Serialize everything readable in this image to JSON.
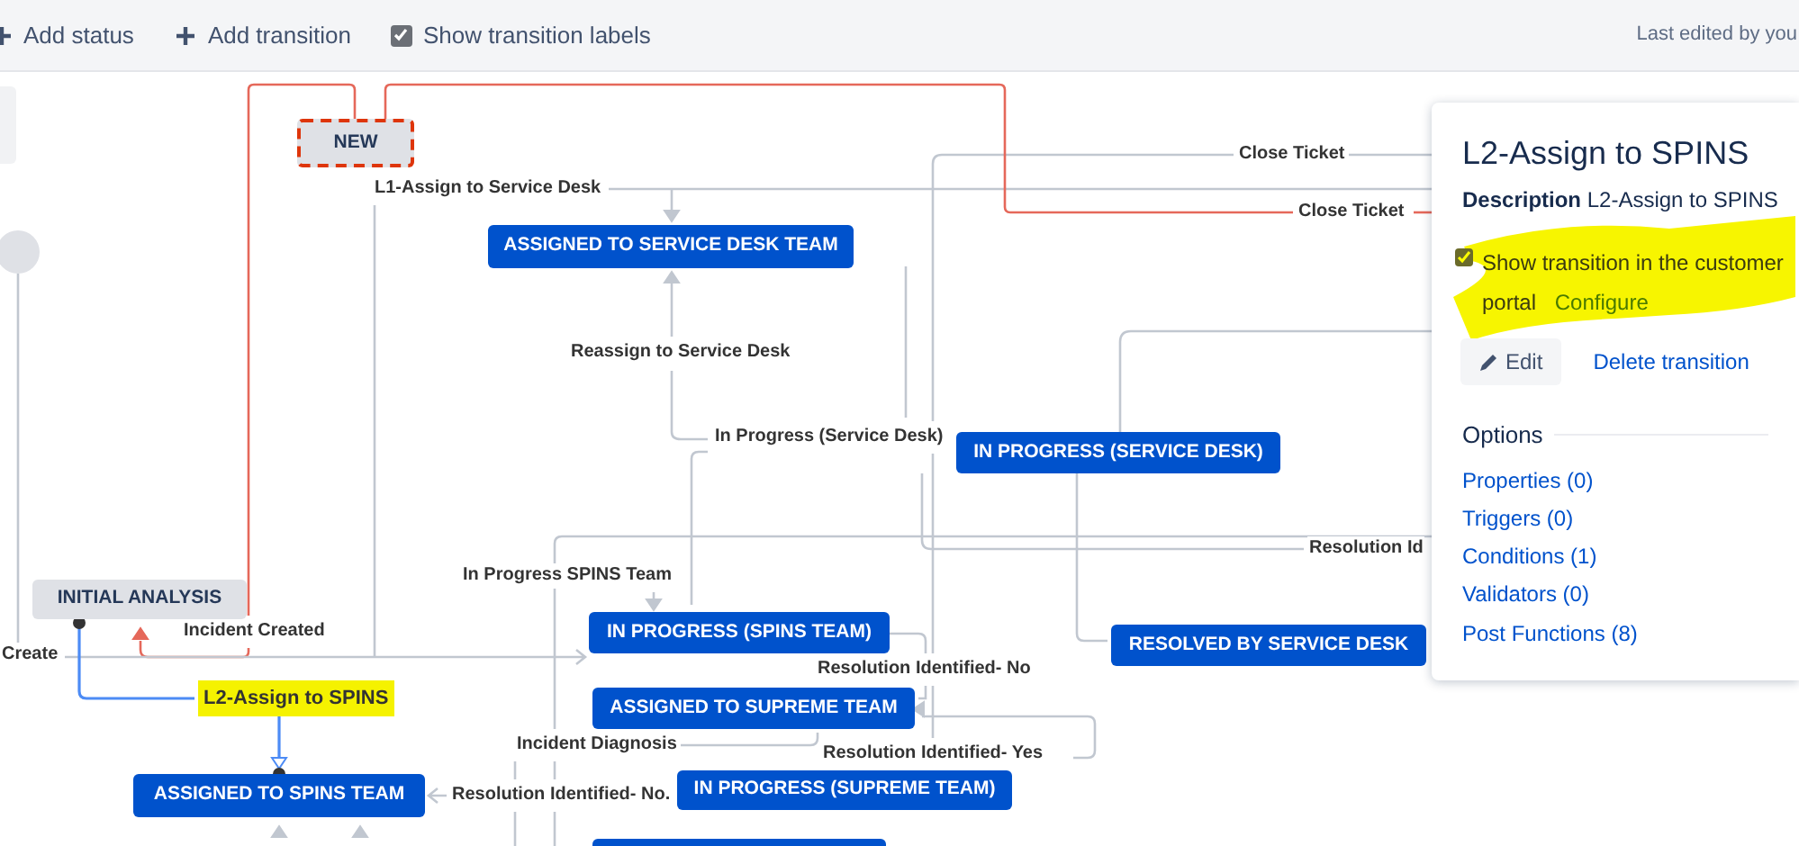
{
  "toolbar": {
    "actions": [
      {
        "label": "Add status"
      },
      {
        "label": "Add transition"
      }
    ],
    "show_labels": {
      "label": "Show transition labels",
      "checked": true
    },
    "last_edited": "Last edited by you"
  },
  "diagram": {
    "statuses": [
      {
        "name": "NEW",
        "kind": "new"
      },
      {
        "name": "ASSIGNED TO SERVICE DESK TEAM",
        "kind": "in-progress"
      },
      {
        "name": "IN PROGRESS (SERVICE DESK)",
        "kind": "in-progress"
      },
      {
        "name": "INITIAL ANALYSIS",
        "kind": "todo"
      },
      {
        "name": "IN PROGRESS (SPINS TEAM)",
        "kind": "in-progress"
      },
      {
        "name": "RESOLVED BY SERVICE DESK",
        "kind": "in-progress"
      },
      {
        "name": "ASSIGNED TO SUPREME TEAM",
        "kind": "in-progress"
      },
      {
        "name": "ASSIGNED TO SPINS TEAM",
        "kind": "in-progress"
      },
      {
        "name": "IN PROGRESS (SUPREME TEAM)",
        "kind": "in-progress"
      },
      {
        "kind": "in-progress"
      }
    ],
    "transitions": [
      {
        "label": "Close Ticket",
        "selected": false,
        "related": false
      },
      {
        "label": "L1-Assign to Service Desk",
        "selected": false,
        "related": false
      },
      {
        "label": "Close Ticket",
        "selected": false,
        "related": true
      },
      {
        "label": "Reassign to Service Desk",
        "selected": false,
        "related": false
      },
      {
        "label": "In Progress (Service Desk)",
        "selected": false,
        "related": false
      },
      {
        "label": "Resolution Id",
        "selected": false,
        "related": false
      },
      {
        "label": "In Progress SPINS Team",
        "selected": false,
        "related": false
      },
      {
        "label": "Incident Created",
        "selected": false,
        "related": true
      },
      {
        "label": "Create",
        "selected": false,
        "related": false
      },
      {
        "label": "Resolution Identified- No",
        "selected": false,
        "related": false
      },
      {
        "label": "L2-Assign to SPINS",
        "selected": true,
        "related": false,
        "highlighted": true
      },
      {
        "label": "Incident Diagnosis",
        "selected": false,
        "related": false
      },
      {
        "label": "Resolution Identified- Yes",
        "selected": false,
        "related": false
      },
      {
        "label": "Resolution Identified- No.",
        "selected": false,
        "related": false
      }
    ]
  },
  "panel": {
    "title": "L2-Assign to SPINS",
    "description_label": "Description",
    "description": "L2-Assign to SPINS",
    "portal_option": {
      "label": "Show transition in the customer portal",
      "checked": true,
      "highlighted": true
    },
    "configure_link": "Configure",
    "edit_button": "Edit",
    "delete_link": "Delete transition",
    "options_heading": "Options",
    "options": [
      {
        "label": "Properties (0)"
      },
      {
        "label": "Triggers (0)"
      },
      {
        "label": "Conditions (1)"
      },
      {
        "label": "Validators (0)"
      },
      {
        "label": "Post Functions (8)"
      }
    ]
  }
}
